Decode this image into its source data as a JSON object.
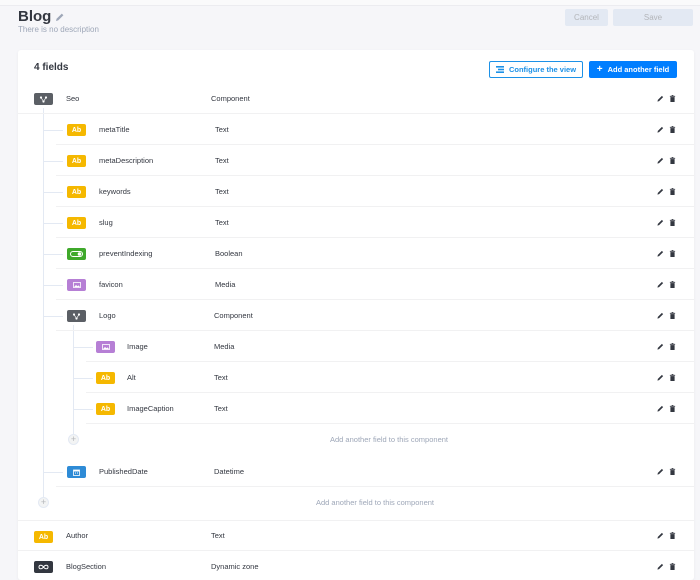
{
  "header": {
    "title": "Blog",
    "description": "There is no description",
    "cancel_label": "Cancel",
    "save_label": "Save"
  },
  "content": {
    "fields_count": "4 fields",
    "configure_label": "Configure the view",
    "add_field_label": "Add another field"
  },
  "fields": {
    "seo": {
      "name": "Seo",
      "type": "Component",
      "badge": "component-icon"
    },
    "metaTitle": {
      "name": "metaTitle",
      "type": "Text",
      "badge": "Ab"
    },
    "metaDescription": {
      "name": "metaDescription",
      "type": "Text",
      "badge": "Ab"
    },
    "keywords": {
      "name": "keywords",
      "type": "Text",
      "badge": "Ab"
    },
    "slug": {
      "name": "slug",
      "type": "Text",
      "badge": "Ab"
    },
    "preventIndexing": {
      "name": "preventIndexing",
      "type": "Boolean",
      "badge": "toggle-icon"
    },
    "favicon": {
      "name": "favicon",
      "type": "Media",
      "badge": "image-icon"
    },
    "logo": {
      "name": "Logo",
      "type": "Component",
      "badge": "component-icon"
    },
    "image": {
      "name": "Image",
      "type": "Media",
      "badge": "image-icon"
    },
    "alt": {
      "name": "Alt",
      "type": "Text",
      "badge": "Ab"
    },
    "imageCaption": {
      "name": "ImageCaption",
      "type": "Text",
      "badge": "Ab"
    },
    "logo_add": "Add another field to this component",
    "publishedDate": {
      "name": "PublishedDate",
      "type": "Datetime",
      "badge": "calendar-icon"
    },
    "seo_add": "Add another field to this component",
    "author": {
      "name": "Author",
      "type": "Text",
      "badge": "Ab"
    },
    "blogSection": {
      "name": "BlogSection",
      "type": "Dynamic zone",
      "badge": "infinity-icon"
    }
  },
  "colors": {
    "primary": "#007eff",
    "text_badge": "#f5b800",
    "component_badge": "#5b5f65",
    "boolean_badge": "#3fa92b",
    "media_badge": "#b67fd5",
    "date_badge": "#2e8bd6"
  }
}
